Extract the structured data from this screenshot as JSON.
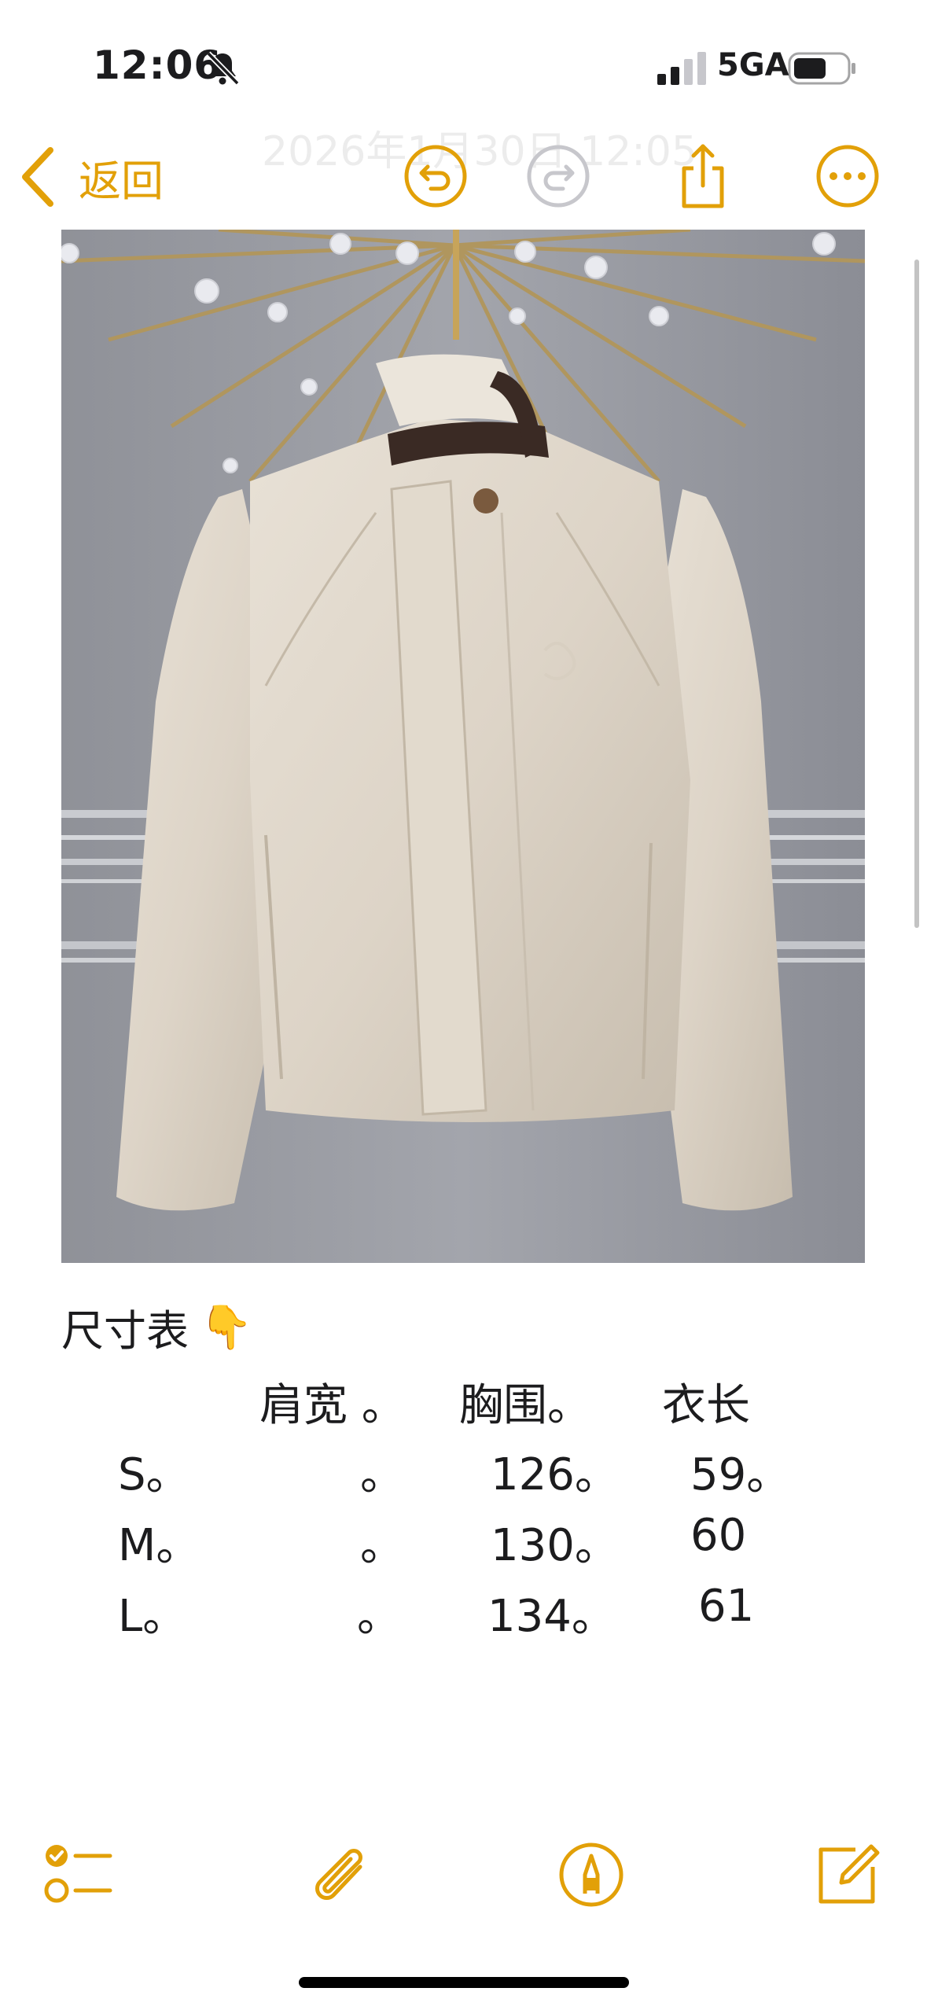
{
  "status_bar": {
    "time": "12:06",
    "network": "5GA",
    "icons": [
      "bell-slash-icon",
      "cellular-signal-icon",
      "battery-icon"
    ]
  },
  "nav": {
    "back_label": "返回",
    "ghost_date": "2026年1月30日 12:05",
    "icons": [
      "chevron-left-icon",
      "undo-icon",
      "redo-icon",
      "share-icon",
      "more-icon"
    ]
  },
  "note": {
    "heading": "尺寸表",
    "heading_emoji": "👇",
    "table": {
      "headers": [
        "肩宽 。",
        "胸围。",
        "衣长"
      ],
      "rows": [
        {
          "size": "S。",
          "shoulder": "。",
          "chest": "126。",
          "length": "59。"
        },
        {
          "size": "M。",
          "shoulder": "。",
          "chest": "130。",
          "length": "60"
        },
        {
          "size": "L。",
          "shoulder": "。",
          "chest": "134。",
          "length": "61"
        }
      ]
    }
  },
  "toolbar": {
    "icons": [
      "checklist-icon",
      "paperclip-icon",
      "markup-pen-icon",
      "compose-icon"
    ]
  },
  "colors": {
    "accent": "#E2A008",
    "disabled": "#C7C7CC",
    "text": "#1C1C1E"
  }
}
